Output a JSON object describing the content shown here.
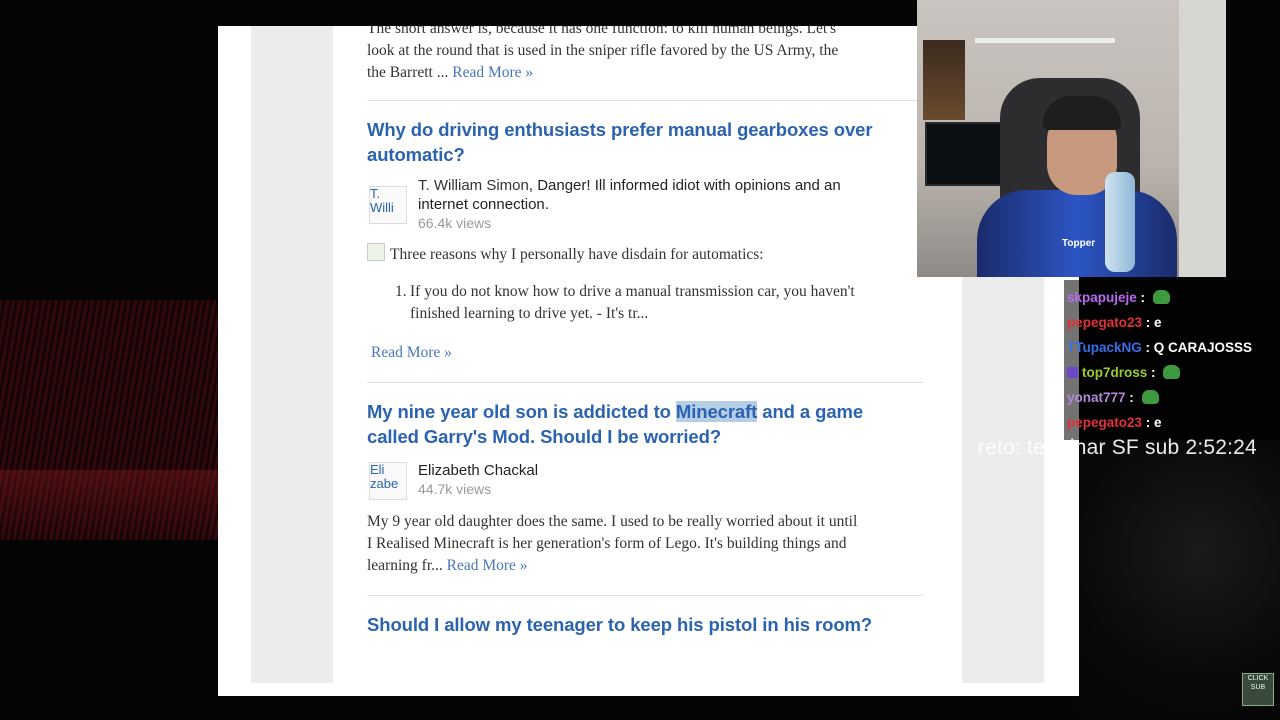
{
  "article": {
    "prev_excerpt": [
      "The short answer is, because it has one function: to kill human beings. Let's",
      "look at the round that is used in the sniper rifle favored by the US Army, the",
      "the Barrett ..."
    ],
    "read_more": "Read More »",
    "q1": {
      "title": [
        "Why do driving enthusiasts prefer manual gearboxes over",
        "automatic?"
      ],
      "avatar_alt": [
        "T.",
        "Willi"
      ],
      "author": "T. William Simon",
      "bio_line1": ", Danger! Ill informed idiot with opinions and an",
      "bio_line2": "internet connection.",
      "views": "66.4k views",
      "intro": "Three reasons why I personally have disdain for automatics:",
      "list_num": "1.",
      "list_item": [
        "If you do not know how to drive a manual transmission car, you haven't",
        "finished learning to drive yet. - It's tr..."
      ]
    },
    "q2": {
      "title_a": "My nine year old son is addicted to ",
      "title_hl": "Minecraft",
      "title_b": " and a game",
      "title_line2": "called Garry's Mod. Should I be worried?",
      "avatar_alt": [
        "Eli",
        "zabe"
      ],
      "author": "Elizabeth Chackal",
      "views": "44.7k views",
      "answer": [
        "My 9 year old daughter does the same. I used to be really worried about it until",
        "I Realised Minecraft is her generation's form of Lego. It's building things and",
        "learning fr..."
      ]
    },
    "q3": {
      "title": "Should I allow my teenager to keep his pistol in his room?"
    }
  },
  "webcam": {
    "brand": "Topper"
  },
  "chat": [
    {
      "user": "skpapujeje",
      "color": "#b86bf0",
      "msg": "",
      "emote": true
    },
    {
      "user": "pepegato23",
      "color": "#e0303a",
      "msg": "e",
      "emote": false
    },
    {
      "user": "TTupackNG",
      "color": "#3a6ee8",
      "msg": "Q CARAJOSSS",
      "emote": false
    },
    {
      "user": "top7dross",
      "color": "#9acd32",
      "msg": "",
      "emote": true,
      "sub": true
    },
    {
      "user": "yonat777",
      "color": "#b08ad8",
      "msg": "",
      "emote": true
    },
    {
      "user": "pepegato23",
      "color": "#e0303a",
      "msg": "e",
      "emote": false
    }
  ],
  "overlay": {
    "goal": "reto: terminar SF sub 2:52:24",
    "badge": "CLICK SUB"
  },
  "colors": {
    "link": "#4a76b8",
    "title": "#2b63b0",
    "highlight": "#b6cde6"
  }
}
